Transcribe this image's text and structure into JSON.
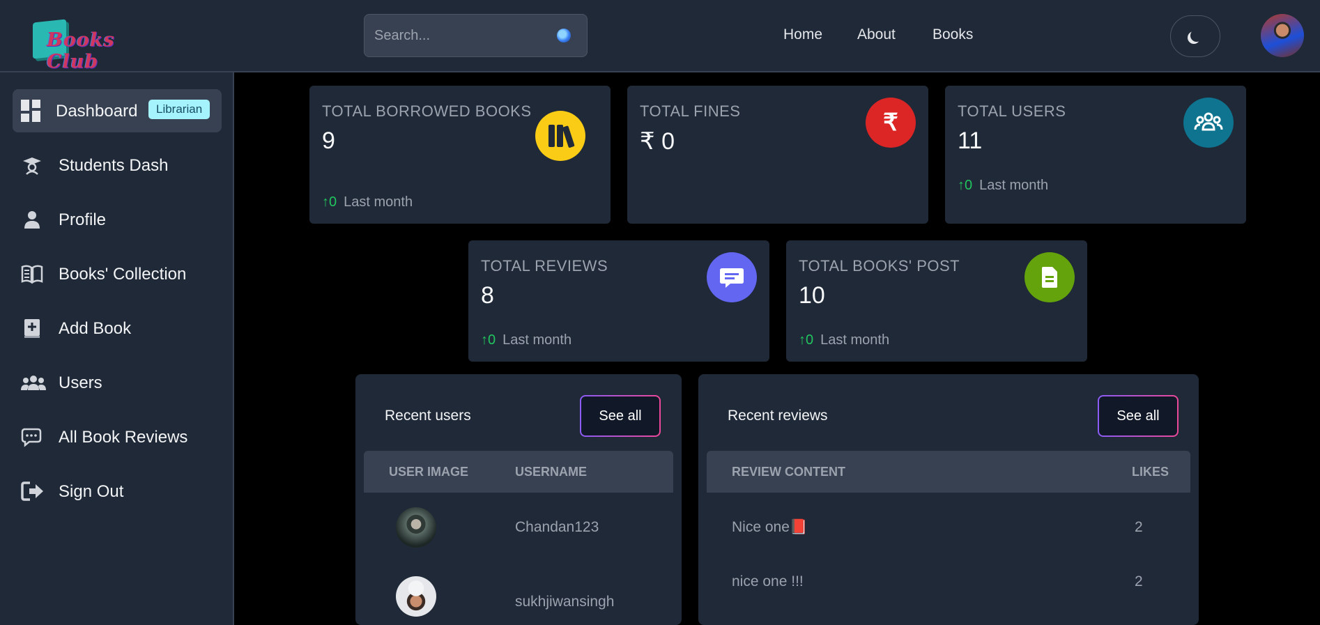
{
  "header": {
    "logo_text": "Books Club",
    "search": {
      "placeholder": "Search..."
    },
    "nav": {
      "home": "Home",
      "about": "About",
      "books": "Books"
    }
  },
  "sidebar": {
    "items": [
      {
        "label": "Dashboard",
        "badge": "Librarian",
        "icon": "dashboard-icon",
        "active": true
      },
      {
        "label": "Students Dash",
        "icon": "graduation-cap-icon"
      },
      {
        "label": "Profile",
        "icon": "person-icon"
      },
      {
        "label": "Books' Collection",
        "icon": "open-book-icon"
      },
      {
        "label": "Add Book",
        "icon": "add-book-icon"
      },
      {
        "label": "Users",
        "icon": "users-icon"
      },
      {
        "label": "All Book Reviews",
        "icon": "chat-bubbles-icon"
      },
      {
        "label": "Sign Out",
        "icon": "sign-out-icon"
      }
    ]
  },
  "stats": [
    {
      "title": "TOTAL BORROWED BOOKS",
      "value": "9",
      "trend_value": "0",
      "trend_label": "Last month",
      "icon": "books-icon",
      "color": "#facc15"
    },
    {
      "title": "TOTAL FINES",
      "value": "₹ 0",
      "icon": "rupee-icon",
      "color": "#dc2626"
    },
    {
      "title": "TOTAL USERS",
      "value": "11",
      "trend_value": "0",
      "trend_label": "Last month",
      "icon": "users-group-icon",
      "color": "#0e7490"
    },
    {
      "title": "TOTAL REVIEWS",
      "value": "8",
      "trend_value": "0",
      "trend_label": "Last month",
      "icon": "message-icon",
      "color": "#6366f1"
    },
    {
      "title": "TOTAL BOOKS' POST",
      "value": "10",
      "trend_value": "0",
      "trend_label": "Last month",
      "icon": "document-icon",
      "color": "#65a30d"
    }
  ],
  "recent_users": {
    "title": "Recent users",
    "see_all": "See all",
    "columns": [
      "USER IMAGE",
      "USERNAME"
    ],
    "rows": [
      {
        "username": "Chandan123"
      },
      {
        "username": "sukhjiwansingh"
      }
    ]
  },
  "recent_reviews": {
    "title": "Recent reviews",
    "see_all": "See all",
    "columns": [
      "REVIEW CONTENT",
      "LIKES"
    ],
    "rows": [
      {
        "content": "Nice one📕",
        "likes": "2"
      },
      {
        "content": "nice one !!!",
        "likes": "2"
      }
    ]
  }
}
